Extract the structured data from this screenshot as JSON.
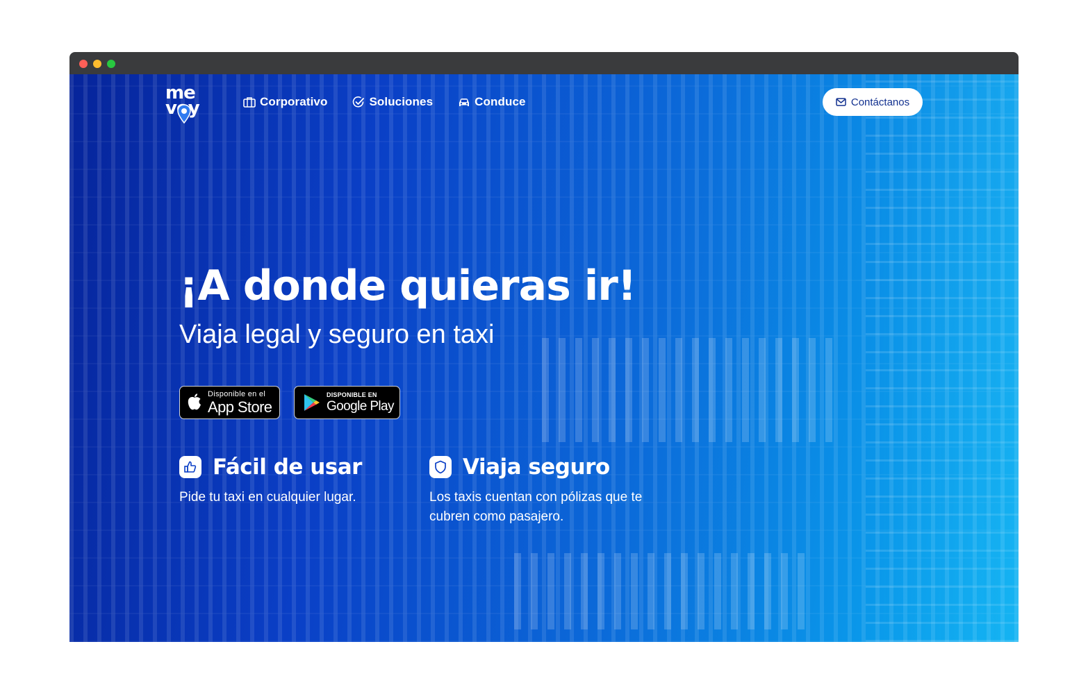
{
  "brand": {
    "logo_line1": "me",
    "logo_line2": "voy"
  },
  "nav": {
    "items": [
      {
        "label": "Corporativo",
        "icon": "briefcase-icon"
      },
      {
        "label": "Soluciones",
        "icon": "check-circle-icon"
      },
      {
        "label": "Conduce",
        "icon": "car-icon"
      }
    ],
    "contact_label": "Contáctanos",
    "contact_icon": "mail-icon"
  },
  "hero": {
    "title": "¡A donde quieras ir!",
    "subtitle": "Viaja legal y seguro en taxi"
  },
  "stores": {
    "apple": {
      "small": "Disponible en el",
      "big": "App Store"
    },
    "google": {
      "small": "DISPONIBLE EN",
      "big": "Google Play"
    }
  },
  "features": [
    {
      "title": "Fácil de usar",
      "text": "Pide tu taxi en cualquier lugar.",
      "icon": "thumbs-up-icon"
    },
    {
      "title": "Viaja seguro",
      "text": "Los taxis cuentan con pólizas que te cubren como pasajero.",
      "icon": "shield-icon"
    }
  ],
  "colors": {
    "gradient_start": "#06249a",
    "gradient_end": "#08b0f2",
    "button_text": "#12318f",
    "titlebar": "#3a3b3d"
  }
}
